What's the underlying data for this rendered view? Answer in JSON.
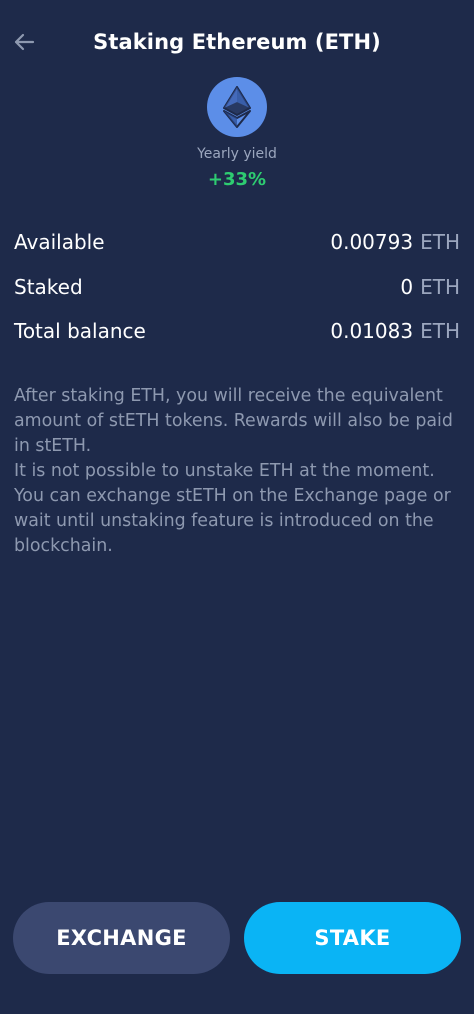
{
  "header": {
    "back_icon": "arrow-left-icon",
    "title": "Staking Ethereum (ETH)"
  },
  "coin": {
    "icon": "ethereum-icon",
    "color": "#5c8ee8"
  },
  "yield": {
    "label": "Yearly yield",
    "value": "+33%",
    "color": "#2ecc71"
  },
  "balances": [
    {
      "label": "Available",
      "value": "0.00793",
      "unit": "ETH"
    },
    {
      "label": "Staked",
      "value": "0",
      "unit": "ETH"
    },
    {
      "label": "Total balance",
      "value": "0.01083",
      "unit": "ETH"
    }
  ],
  "info": {
    "paragraph1": "After staking ETH, you will receive the equivalent amount of stETH tokens. Rewards will also be paid in stETH.",
    "paragraph2": "It is not possible to unstake ETH at the moment. You can exchange stETH on the Exchange page or wait until unstaking feature is introduced on the blockchain."
  },
  "buttons": {
    "exchange_label": "EXCHANGE",
    "stake_label": "STAKE",
    "stake_color": "#0ab4f5"
  }
}
